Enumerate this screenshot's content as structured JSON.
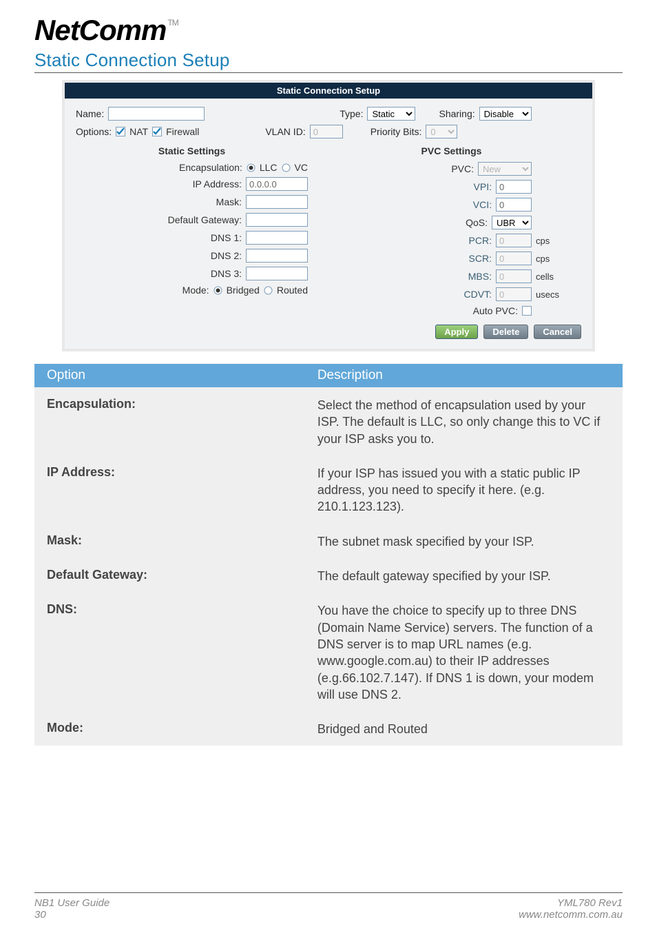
{
  "logo_text": "NetComm",
  "logo_tm": "TM",
  "heading": "Static Connection Setup",
  "app": {
    "title": "Static Connection Setup",
    "name_label": "Name:",
    "name_value": "",
    "type_label": "Type:",
    "type_value": "Static",
    "sharing_label": "Sharing:",
    "sharing_value": "Disable",
    "options_label": "Options:",
    "nat_label": "NAT",
    "firewall_label": "Firewall",
    "vlan_label": "VLAN ID:",
    "vlan_value": "0",
    "priority_label": "Priority Bits:",
    "priority_value": "0",
    "static": {
      "head": "Static Settings",
      "encap_label": "Encapsulation:",
      "encap_llc": "LLC",
      "encap_vc": "VC",
      "ip_label": "IP Address:",
      "ip_value": "0.0.0.0",
      "mask_label": "Mask:",
      "mask_value": "",
      "gw_label": "Default Gateway:",
      "gw_value": "",
      "dns1_label": "DNS 1:",
      "dns1_value": "",
      "dns2_label": "DNS 2:",
      "dns2_value": "",
      "dns3_label": "DNS 3:",
      "dns3_value": "",
      "mode_label": "Mode:",
      "mode_bridged": "Bridged",
      "mode_routed": "Routed"
    },
    "pvc": {
      "head": "PVC Settings",
      "pvc_label": "PVC:",
      "pvc_value": "New",
      "vpi_label": "VPI:",
      "vpi_value": "0",
      "vci_label": "VCI:",
      "vci_value": "0",
      "qos_label": "QoS:",
      "qos_value": "UBR",
      "pcr_label": "PCR:",
      "pcr_value": "0",
      "pcr_unit": "cps",
      "scr_label": "SCR:",
      "scr_value": "0",
      "scr_unit": "cps",
      "mbs_label": "MBS:",
      "mbs_value": "0",
      "mbs_unit": "cells",
      "cdvt_label": "CDVT:",
      "cdvt_value": "0",
      "cdvt_unit": "usecs",
      "auto_label": "Auto PVC:"
    },
    "buttons": {
      "apply": "Apply",
      "del": "Delete",
      "cancel": "Cancel"
    }
  },
  "table": {
    "h1": "Option",
    "h2": "Description",
    "rows": [
      {
        "opt": "Encapsulation:",
        "desc": "Select the method of encapsulation used by your ISP.  The default is LLC, so only change this to VC if your ISP asks you to."
      },
      {
        "opt": "IP Address:",
        "desc": "If your ISP has issued you with a static public IP address, you need to specify it here. (e.g. 210.1.123.123)."
      },
      {
        "opt": "Mask:",
        "desc": "The subnet mask specified by your ISP."
      },
      {
        "opt": "Default Gateway:",
        "desc": "The default gateway specified by your ISP."
      },
      {
        "opt": "DNS:",
        "desc": "You have the choice to specify up to three DNS (Domain Name Service) servers. The function of a DNS server is to map URL names (e.g. www.google.com.au) to their IP addresses (e.g.66.102.7.147). If DNS 1 is down, your modem will use DNS 2."
      },
      {
        "opt": "Mode:",
        "desc": "Bridged and Routed"
      }
    ]
  },
  "footer": {
    "l1": "NB1 User Guide",
    "l2": "30",
    "r1": "YML780 Rev1",
    "r2": "www.netcomm.com.au"
  }
}
